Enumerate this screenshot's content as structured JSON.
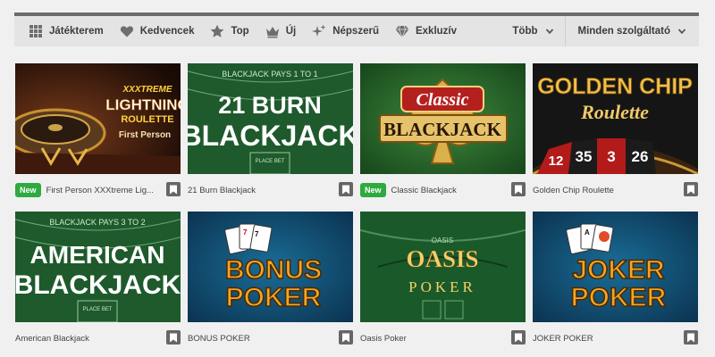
{
  "filters": [
    {
      "label": "Játékterem",
      "icon": "grid-icon"
    },
    {
      "label": "Kedvencek",
      "icon": "heart-icon"
    },
    {
      "label": "Top",
      "icon": "star-icon"
    },
    {
      "label": "Új",
      "icon": "crown-icon"
    },
    {
      "label": "Népszerű",
      "icon": "sparkle-icon"
    },
    {
      "label": "Exkluzív",
      "icon": "diamond-icon"
    }
  ],
  "dropdowns": {
    "more_label": "Több",
    "provider_label": "Minden szolgáltató"
  },
  "games": [
    {
      "name": "First Person XXXtreme Lig...",
      "badge": "New",
      "art": {
        "line1": "XXXTREME",
        "line2": "LIGHTNING",
        "line3": "ROULETTE",
        "line4": "First Person"
      }
    },
    {
      "name": "21 Burn Blackjack",
      "badge": "",
      "art": {
        "line1": "21 BURN",
        "line2": "BLACKJACK",
        "table_text": "BLACKJACK PAYS 1 TO 1",
        "bet": "PLACE BET"
      }
    },
    {
      "name": "Classic Blackjack",
      "badge": "New",
      "art": {
        "line1": "Classic",
        "line2": "BLACKJACK"
      }
    },
    {
      "name": "Golden Chip Roulette",
      "badge": "",
      "art": {
        "line1": "GOLDEN CHIP",
        "line2": "Roulette",
        "nums": [
          "12",
          "35",
          "3",
          "26"
        ]
      }
    },
    {
      "name": "American Blackjack",
      "badge": "",
      "art": {
        "line1": "AMERICAN",
        "line2": "BLACKJACK",
        "table_text": "BLACKJACK PAYS 3 TO 2",
        "bet": "PLACE BET"
      }
    },
    {
      "name": "BONUS POKER",
      "badge": "",
      "art": {
        "line1": "BONUS",
        "line2": "POKER"
      }
    },
    {
      "name": "Oasis Poker",
      "badge": "",
      "art": {
        "line1": "OASIS",
        "line2": "POKER",
        "small": "OASIS"
      }
    },
    {
      "name": "JOKER POKER",
      "badge": "",
      "art": {
        "line1": "JOKER",
        "line2": "POKER"
      }
    }
  ],
  "colors": {
    "accent_green": "#2eaa3f",
    "felt_green": "#1f5a2c",
    "poker_blue": "#0e4b73",
    "gold": "#e0b24a"
  }
}
